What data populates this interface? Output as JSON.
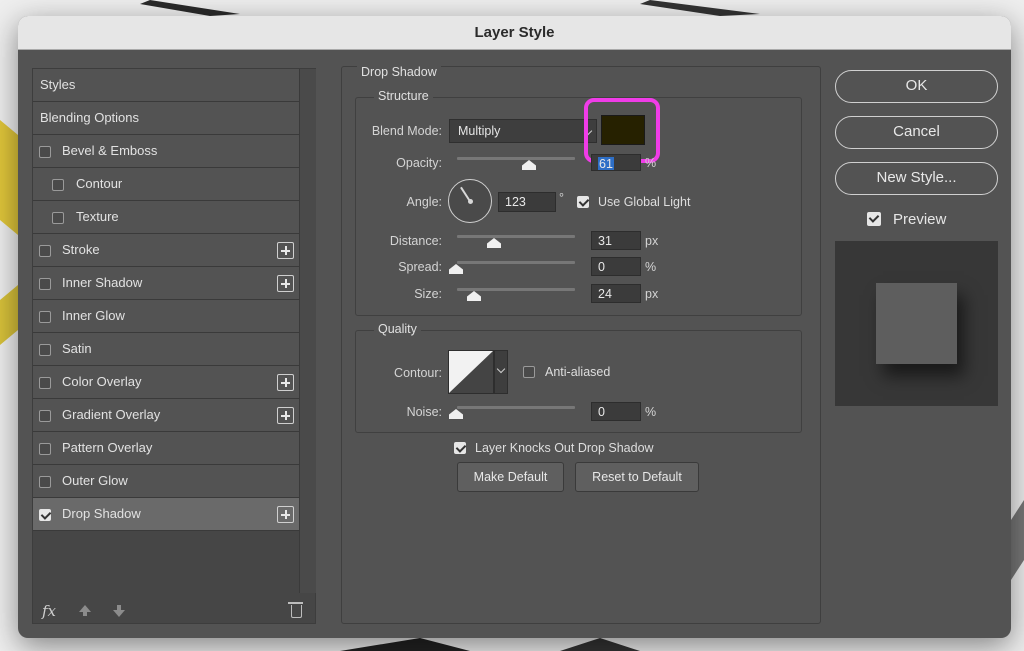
{
  "dialog": {
    "title": "Layer Style"
  },
  "left_panel": {
    "items": [
      {
        "label": "Styles",
        "checkbox": false,
        "checked": false,
        "plus": false,
        "indent": false
      },
      {
        "label": "Blending Options",
        "checkbox": false,
        "checked": false,
        "plus": false,
        "indent": false
      },
      {
        "label": "Bevel & Emboss",
        "checkbox": true,
        "checked": false,
        "plus": false,
        "indent": false
      },
      {
        "label": "Contour",
        "checkbox": true,
        "checked": false,
        "plus": false,
        "indent": true
      },
      {
        "label": "Texture",
        "checkbox": true,
        "checked": false,
        "plus": false,
        "indent": true
      },
      {
        "label": "Stroke",
        "checkbox": true,
        "checked": false,
        "plus": true,
        "indent": false
      },
      {
        "label": "Inner Shadow",
        "checkbox": true,
        "checked": false,
        "plus": true,
        "indent": false
      },
      {
        "label": "Inner Glow",
        "checkbox": true,
        "checked": false,
        "plus": false,
        "indent": false
      },
      {
        "label": "Satin",
        "checkbox": true,
        "checked": false,
        "plus": false,
        "indent": false
      },
      {
        "label": "Color Overlay",
        "checkbox": true,
        "checked": false,
        "plus": true,
        "indent": false
      },
      {
        "label": "Gradient Overlay",
        "checkbox": true,
        "checked": false,
        "plus": true,
        "indent": false
      },
      {
        "label": "Pattern Overlay",
        "checkbox": true,
        "checked": false,
        "plus": false,
        "indent": false
      },
      {
        "label": "Outer Glow",
        "checkbox": true,
        "checked": false,
        "plus": false,
        "indent": false
      },
      {
        "label": "Drop Shadow",
        "checkbox": true,
        "checked": true,
        "plus": true,
        "indent": false,
        "active": true
      }
    ],
    "footer": {
      "fx_label": "fx",
      "icons": [
        "fx-icon",
        "move-up-icon",
        "move-down-icon",
        "trash-icon"
      ]
    }
  },
  "drop_shadow": {
    "section_title": "Drop Shadow",
    "structure": {
      "title": "Structure",
      "blend_mode_label": "Blend Mode:",
      "blend_mode_value": "Multiply",
      "shadow_color": "#262100",
      "highlight_color": "#f03ce8",
      "opacity_label": "Opacity:",
      "opacity_value": "61",
      "opacity_unit": "%",
      "opacity_level": 0.61,
      "angle_label": "Angle:",
      "angle_value": "123",
      "angle_unit": "°",
      "use_global_light_label": "Use Global Light",
      "use_global_light": true,
      "distance_label": "Distance:",
      "distance_value": "31",
      "distance_unit": "px",
      "spread_label": "Spread:",
      "spread_value": "0",
      "spread_unit": "%",
      "size_label": "Size:",
      "size_value": "24",
      "size_unit": "px"
    },
    "quality": {
      "title": "Quality",
      "contour_label": "Contour:",
      "anti_aliased_label": "Anti-aliased",
      "anti_aliased": false,
      "noise_label": "Noise:",
      "noise_value": "0",
      "noise_unit": "%"
    },
    "layer_knocks_out_label": "Layer Knocks Out Drop Shadow",
    "layer_knocks_out": true,
    "make_default_label": "Make Default",
    "reset_default_label": "Reset to Default"
  },
  "actions": {
    "ok_label": "OK",
    "cancel_label": "Cancel",
    "new_style_label": "New Style...",
    "preview_label": "Preview",
    "preview_checked": true
  }
}
